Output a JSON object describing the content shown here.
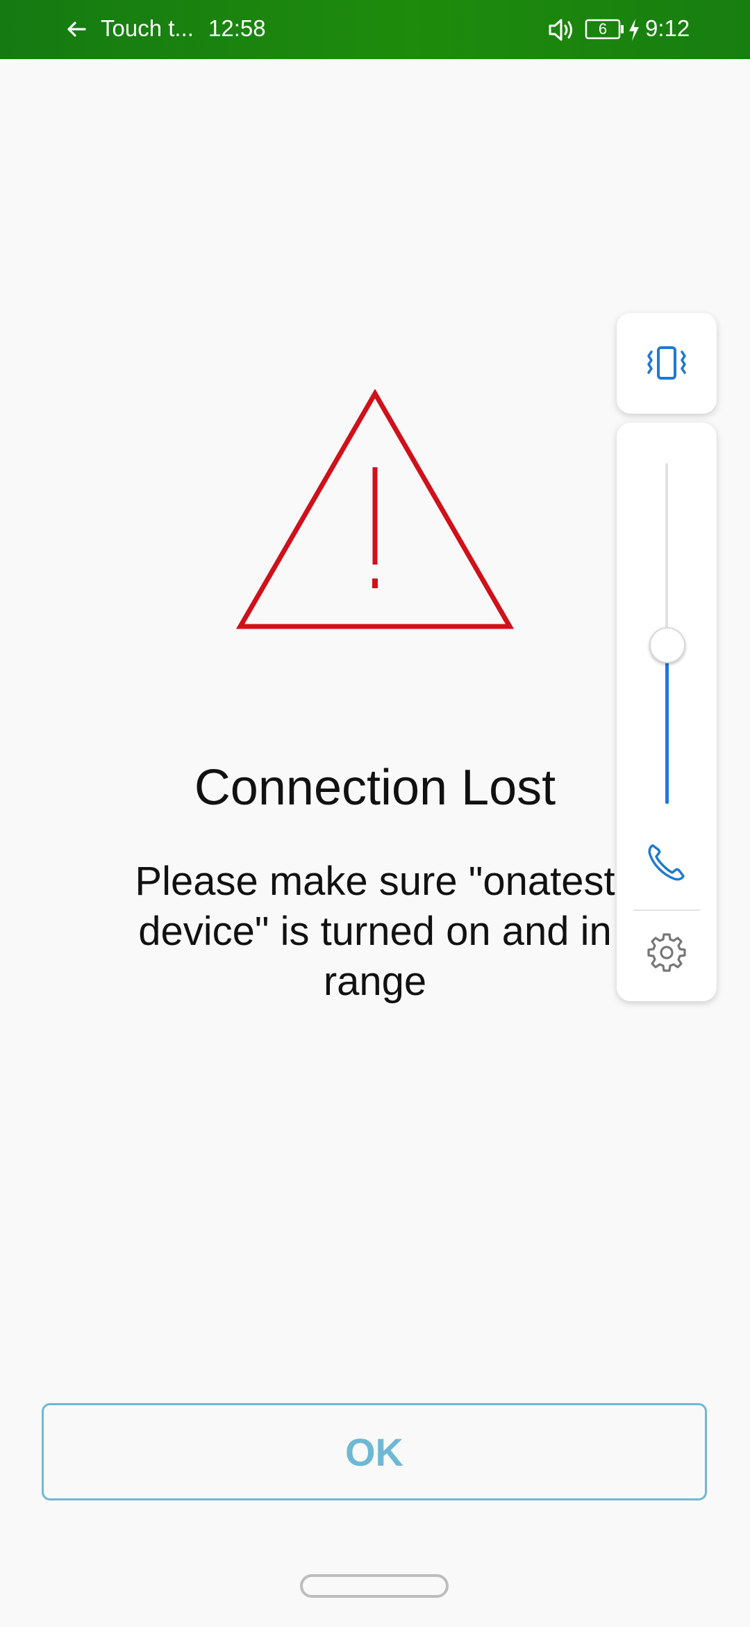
{
  "status_bar": {
    "app_label": "Touch t...",
    "call_time": "12:58",
    "battery_level": "6",
    "clock": "9:12",
    "icons": [
      "back-arrow-icon",
      "speaker-icon",
      "battery-icon",
      "charging-icon"
    ]
  },
  "dialog": {
    "title": "Connection Lost",
    "message": "Please make sure \"onatest device\" is turned on and in range",
    "ok_label": "OK",
    "warning_color": "#d0101a"
  },
  "volume_panel": {
    "icons": [
      "vibrate-icon",
      "phone-icon",
      "gear-icon"
    ],
    "level": 0.47,
    "accent_color": "#1f78d1"
  },
  "colors": {
    "status_bar": "#1a840f",
    "background": "#f9f9f9",
    "button": "#6fb8d4"
  }
}
